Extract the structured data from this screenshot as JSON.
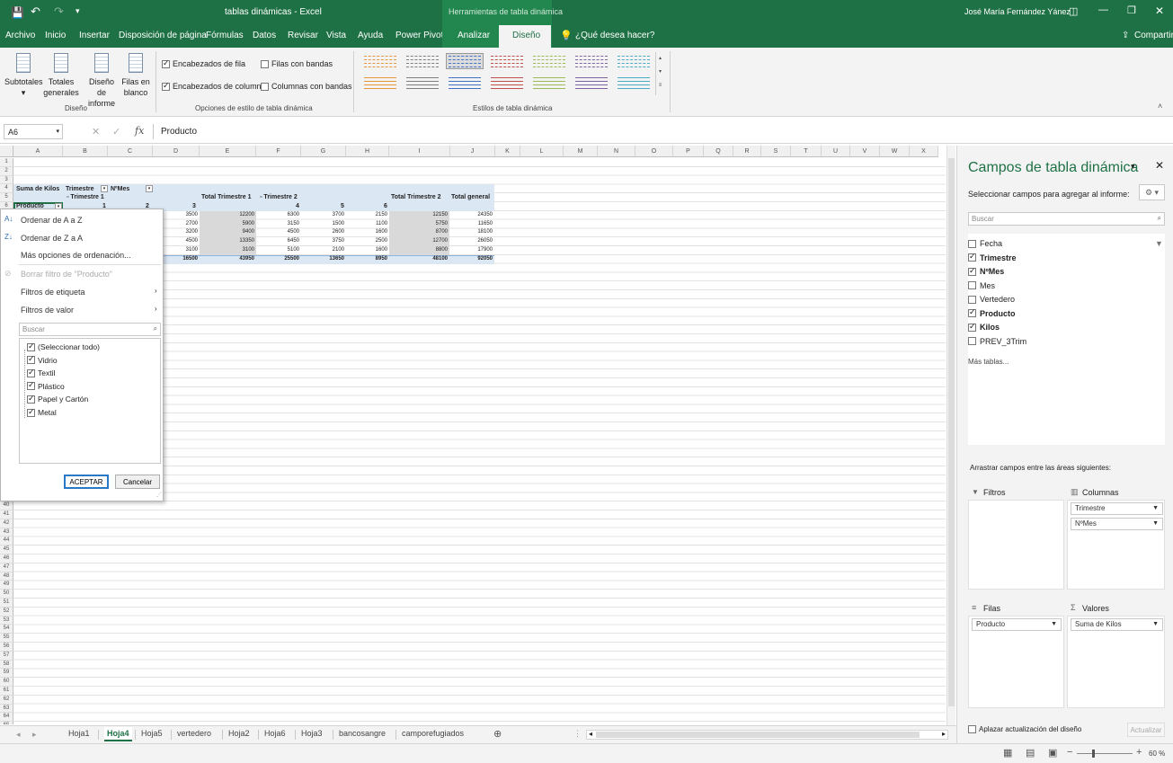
{
  "title": {
    "doc_title": "tablas dinámicas - Excel",
    "contextual_tools": "Herramientas de tabla dinámica",
    "user": "José María Fernández Yánez"
  },
  "menu": {
    "items": [
      "Archivo",
      "Inicio",
      "Insertar",
      "Disposición de página",
      "Fórmulas",
      "Datos",
      "Revisar",
      "Vista",
      "Ayuda",
      "Power Pivot",
      "Analizar",
      "Diseño"
    ],
    "tell_me": "¿Qué desea hacer?",
    "share": "Compartir",
    "active": "Diseño"
  },
  "ribbon": {
    "subtotales": "Subtotales",
    "totales": "Totales generales",
    "diseno_informe": "Diseño de informe",
    "filas_blanco": "Filas en blanco",
    "group_diseno": "Diseño",
    "opt_encab_fila": "Encabezados de fila",
    "opt_encab_col": "Encabezados de columna",
    "opt_filas_bandas": "Filas con bandas",
    "opt_cols_bandas": "Columnas con bandas",
    "group_opciones": "Opciones de estilo de tabla dinámica",
    "group_estilos": "Estilos de tabla dinámica",
    "style_colors": [
      "#e6973c",
      "#7f7f7f",
      "#4472c4",
      "#c0504d",
      "#9bbb59",
      "#8064a2",
      "#4bacc6"
    ]
  },
  "formula": {
    "name_box": "A6",
    "content": "Producto"
  },
  "grid": {
    "columns": [
      "A",
      "B",
      "C",
      "D",
      "E",
      "F",
      "G",
      "H",
      "I",
      "J",
      "K",
      "L",
      "M",
      "N",
      "O",
      "P",
      "Q",
      "R",
      "S",
      "T",
      "U",
      "V",
      "W",
      "X"
    ],
    "rows_top": [
      "1",
      "2",
      "3",
      "4",
      "5",
      "6"
    ],
    "rows_bottom": [
      "40",
      "41",
      "42",
      "43",
      "44",
      "45",
      "46",
      "47",
      "48",
      "49",
      "50",
      "51",
      "52",
      "53",
      "54",
      "55",
      "56",
      "57",
      "58",
      "59",
      "60",
      "61",
      "62",
      "63",
      "64",
      "65"
    ],
    "pivot": {
      "suma_label": "Suma de Kilos",
      "trimestre_hdr": "Trimestre",
      "nmes_hdr": "NºMes",
      "trimestre1": "Trimestre 1",
      "total_t1": "Total Trimestre 1",
      "trimestre2": "Trimestre 2",
      "total_t2": "Total Trimestre 2",
      "total_general": "Total general",
      "producto_hdr": "Producto",
      "month_numbers": [
        "1",
        "2",
        "3",
        "4",
        "5",
        "6"
      ],
      "rows": [
        [
          "3500",
          "12200",
          "6300",
          "3700",
          "2150",
          "12150",
          "24350"
        ],
        [
          "2700",
          "5900",
          "3150",
          "1500",
          "1100",
          "5750",
          "11650"
        ],
        [
          "3200",
          "9400",
          "4500",
          "2600",
          "1600",
          "8700",
          "18100"
        ],
        [
          "4500",
          "13350",
          "6450",
          "3750",
          "2500",
          "12700",
          "26050"
        ],
        [
          "3100",
          "3100",
          "5100",
          "2100",
          "1600",
          "8800",
          "17900"
        ]
      ],
      "totals": [
        "16500",
        "43950",
        "25500",
        "13650",
        "8950",
        "48100",
        "92050"
      ]
    }
  },
  "dropdown": {
    "sort_az": "Ordenar de A a Z",
    "sort_za": "Ordenar de Z a A",
    "more_sort": "Más opciones de ordenación...",
    "clear_filter": "Borrar filtro de \"Producto\"",
    "label_filters": "Filtros de etiqueta",
    "value_filters": "Filtros de valor",
    "search_placeholder": "Buscar",
    "items": [
      "(Seleccionar todo)",
      "Vidrio",
      "Textil",
      "Plástico",
      "Papel y Cartón",
      "Metal"
    ],
    "ok": "ACEPTAR",
    "cancel": "Cancelar"
  },
  "pivot_pane": {
    "title": "Campos de tabla dinámica",
    "subtitle": "Seleccionar campos para agregar al informe:",
    "search_placeholder": "Buscar",
    "fields": [
      {
        "name": "Fecha",
        "checked": false
      },
      {
        "name": "Trimestre",
        "checked": true
      },
      {
        "name": "NºMes",
        "checked": true
      },
      {
        "name": "Mes",
        "checked": false
      },
      {
        "name": "Vertedero",
        "checked": false
      },
      {
        "name": "Producto",
        "checked": true
      },
      {
        "name": "Kilos",
        "checked": true
      },
      {
        "name": "PREV_3Trim",
        "checked": false
      }
    ],
    "more_tables": "Más tablas...",
    "drag_hint": "Arrastrar campos entre las áreas siguientes:",
    "filters_label": "Filtros",
    "columns_label": "Columnas",
    "rows_label": "Filas",
    "values_label": "Valores",
    "columns_items": [
      "Trimestre",
      "NºMes"
    ],
    "rows_items": [
      "Producto"
    ],
    "values_items": [
      "Suma de Kilos"
    ],
    "defer_label": "Aplazar actualización del diseño",
    "update_button": "Actualizar"
  },
  "sheets": {
    "tabs": [
      "Hoja1",
      "Hoja4",
      "Hoja5",
      "vertedero",
      "Hoja2",
      "Hoja6",
      "Hoja3",
      "bancosangre",
      "camporefugiados"
    ],
    "active": "Hoja4"
  },
  "status": {
    "zoom": "60 %"
  }
}
